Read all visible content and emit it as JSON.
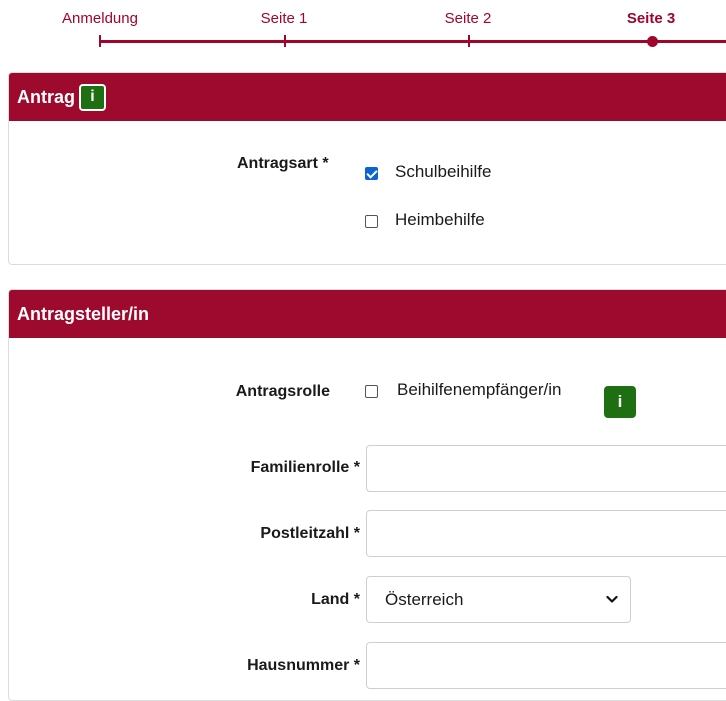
{
  "stepper": {
    "steps": [
      {
        "label": "Anmeldung"
      },
      {
        "label": "Seite 1"
      },
      {
        "label": "Seite 2"
      },
      {
        "label": "Seite 3"
      }
    ],
    "active_step": "Seite 3"
  },
  "antrag": {
    "title": "Antrag",
    "info_icon": "i",
    "antragsart_label": "Antragsart *",
    "options": [
      {
        "label": "Schulbeihilfe",
        "checked": true
      },
      {
        "label": "Heimbehilfe",
        "checked": false
      }
    ]
  },
  "antragsteller": {
    "title": "Antragsteller/in",
    "antragsrolle_label": "Antragsrolle",
    "antragsrolle_option": {
      "label": "Beihilfenempfänger/in",
      "checked": false
    },
    "info_icon": "i",
    "familienrolle_label": "Familienrolle *",
    "familienrolle_value": "",
    "postleitzahl_label": "Postleitzahl *",
    "postleitzahl_value": "",
    "land_label": "Land *",
    "land_value": "Österreich",
    "hausnummer_label": "Hausnummer *",
    "hausnummer_value": ""
  },
  "colors": {
    "brand": "#9e0a2d",
    "info_badge": "#1e6e12",
    "checkbox_checked": "#0a64d2"
  }
}
